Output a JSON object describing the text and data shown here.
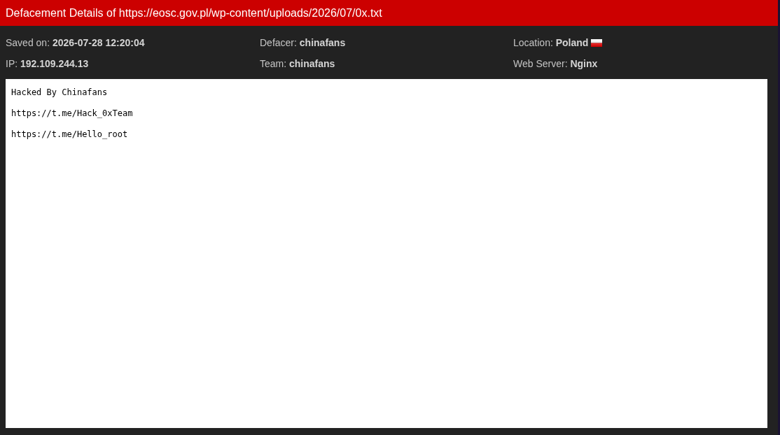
{
  "header": {
    "title": "Defacement Details of https://eosc.gov.pl/wp-content/uploads/2026/07/0x.txt"
  },
  "details": [
    {
      "kind": "text",
      "label": "Saved on:",
      "value": "2026-07-28 12:20:04"
    },
    {
      "kind": "text",
      "label": "Defacer:",
      "value": "chinafans"
    },
    {
      "kind": "flag",
      "label": "Location:",
      "value": "Poland"
    },
    {
      "kind": "text",
      "label": "IP:",
      "value": "192.109.244.13"
    },
    {
      "kind": "text",
      "label": "Team:",
      "value": "chinafans"
    },
    {
      "kind": "text",
      "label": "Web Server:",
      "value": "Nginx"
    }
  ],
  "mirror": {
    "lines": [
      "Hacked By Chinafans",
      "https://t.me/Hack_0xTeam",
      "https://t.me/Hello_root"
    ]
  }
}
